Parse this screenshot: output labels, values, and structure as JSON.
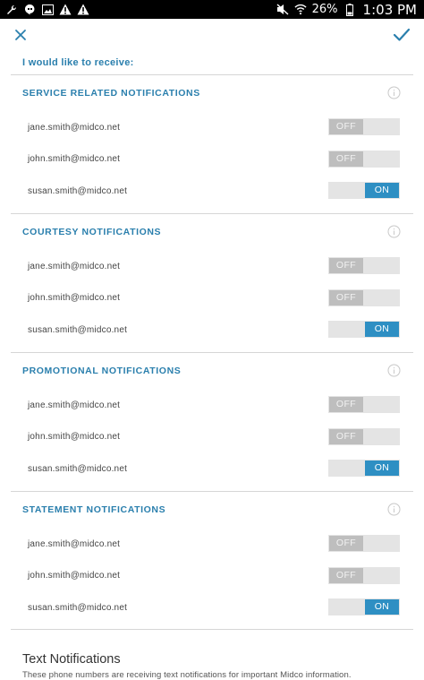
{
  "status_bar": {
    "battery": "26%",
    "time": "1:03 PM"
  },
  "intro_text": "I would like to receive:",
  "sections": [
    {
      "title": "SERVICE RELATED NOTIFICATIONS",
      "recipients": [
        {
          "email": "jane.smith@midco.net",
          "toggle": "OFF"
        },
        {
          "email": "john.smith@midco.net",
          "toggle": "OFF"
        },
        {
          "email": "susan.smith@midco.net",
          "toggle": "ON"
        }
      ]
    },
    {
      "title": "COURTESY NOTIFICATIONS",
      "recipients": [
        {
          "email": "jane.smith@midco.net",
          "toggle": "OFF"
        },
        {
          "email": "john.smith@midco.net",
          "toggle": "OFF"
        },
        {
          "email": "susan.smith@midco.net",
          "toggle": "ON"
        }
      ]
    },
    {
      "title": "PROMOTIONAL NOTIFICATIONS",
      "recipients": [
        {
          "email": "jane.smith@midco.net",
          "toggle": "OFF"
        },
        {
          "email": "john.smith@midco.net",
          "toggle": "OFF"
        },
        {
          "email": "susan.smith@midco.net",
          "toggle": "ON"
        }
      ]
    },
    {
      "title": "STATEMENT NOTIFICATIONS",
      "recipients": [
        {
          "email": "jane.smith@midco.net",
          "toggle": "OFF"
        },
        {
          "email": "john.smith@midco.net",
          "toggle": "OFF"
        },
        {
          "email": "susan.smith@midco.net",
          "toggle": "ON"
        }
      ]
    }
  ],
  "text_notifications": {
    "title": "Text Notifications",
    "description": "These phone numbers are receiving text notifications for important Midco information."
  },
  "colors": {
    "accent": "#2a7fad",
    "toggle_on": "#2e8fc3",
    "toggle_off": "#bebebe"
  }
}
